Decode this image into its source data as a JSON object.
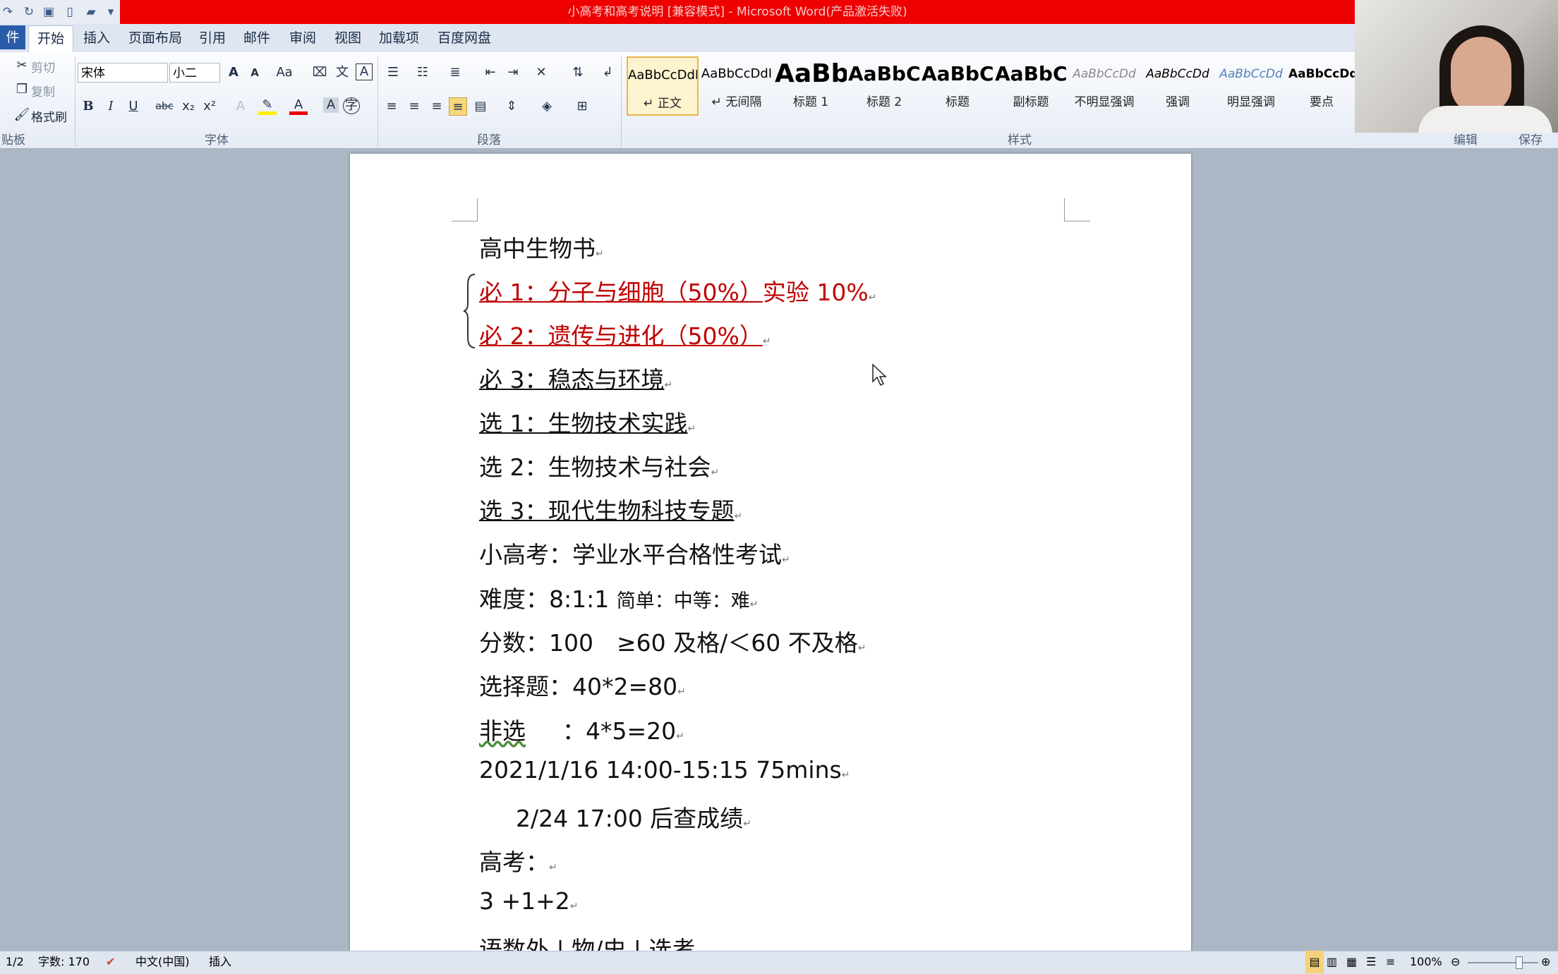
{
  "window": {
    "title": "小高考和高考说明 [兼容模式] - Microsoft Word(产品激活失败)"
  },
  "tabs": [
    "件",
    "开始",
    "插入",
    "页面布局",
    "引用",
    "邮件",
    "审阅",
    "视图",
    "加载项",
    "百度网盘"
  ],
  "clipboard": {
    "cut": "剪切",
    "copy": "复制",
    "painter": "格式刷",
    "label": "贴板"
  },
  "font": {
    "name": "宋体",
    "size": "小二",
    "label": "字体"
  },
  "paragraph": {
    "label": "段落"
  },
  "styles": {
    "label": "样式",
    "items": [
      {
        "preview": "AaBbCcDdI",
        "name": "↵ 正文"
      },
      {
        "preview": "AaBbCcDdI",
        "name": "↵ 无间隔"
      },
      {
        "preview": "AaBb",
        "name": "标题 1"
      },
      {
        "preview": "AaBbC",
        "name": "标题 2"
      },
      {
        "preview": "AaBbC",
        "name": "标题"
      },
      {
        "preview": "AaBbC",
        "name": "副标题"
      },
      {
        "preview": "AaBbCcDd",
        "name": "不明显强调"
      },
      {
        "preview": "AaBbCcDd",
        "name": "强调"
      },
      {
        "preview": "AaBbCcDd",
        "name": "明显强调"
      },
      {
        "preview": "AaBbCcDd",
        "name": "要点"
      }
    ]
  },
  "edit_label": "编辑",
  "save_label": "保存",
  "document": {
    "lines": [
      "高中生物书",
      "必 1：分子与细胞（50%）",
      "实验 10%",
      "必 2：遗传与进化（50%）",
      "必 3：稳态与环境",
      "选 1：生物技术实践",
      "选 2：生物技术与社会",
      "选 3：现代生物科技专题",
      "小高考：学业水平合格性考试",
      "难度：8:1:1",
      "简单：中等：难",
      "分数：100　≥60 及格/＜60 不及格",
      "选择题：40*2=80",
      "非选",
      "：4*5=20",
      "2021/1/16 14:00-15:15 75mins",
      "2/24 17:00 后查成绩",
      "高考：",
      "3 +1+2",
      "语数外 | 物/史 | 选考"
    ],
    "para_mark": "↵"
  },
  "status": {
    "page": "1/2",
    "words": "字数: 170",
    "lang": "中文(中国)",
    "mode": "插入",
    "zoom": "100%"
  },
  "colors": {
    "accent": "#2a5caa",
    "title_bar": "#ee0000",
    "doc_red": "#c00000"
  }
}
